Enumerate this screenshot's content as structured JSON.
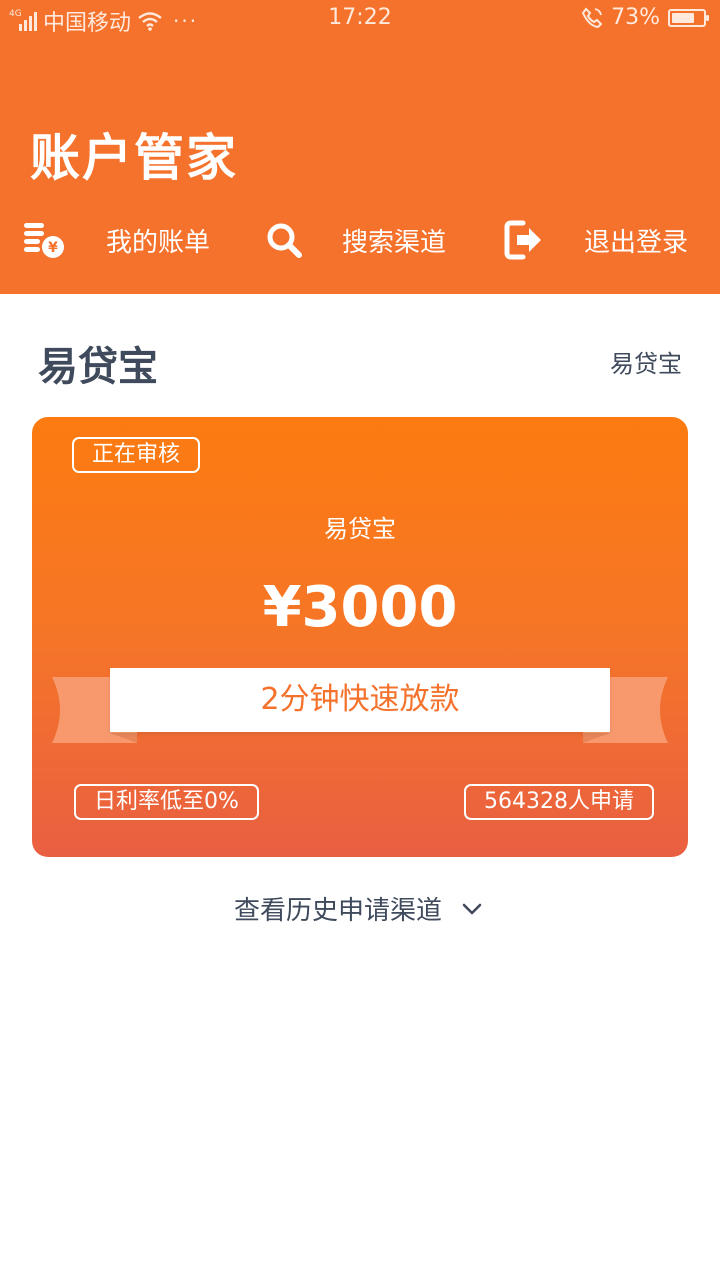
{
  "status_bar": {
    "network": "4G",
    "carrier": "中国移动",
    "time": "17:22",
    "battery": "73%",
    "battery_level": 0.73
  },
  "header": {
    "title": "账户管家",
    "bg_color": "#F5722D"
  },
  "nav": [
    {
      "label": "我的账单",
      "icon": "bill-coin-icon"
    },
    {
      "label": "搜索渠道",
      "icon": "search-icon"
    },
    {
      "label": "退出登录",
      "icon": "logout-icon"
    }
  ],
  "section": {
    "title": "易贷宝",
    "link": "易贷宝"
  },
  "card": {
    "status": "正在审核",
    "name": "易贷宝",
    "amount": "¥3000",
    "banner": "2分钟快速放款",
    "rate": "日利率低至0%",
    "applicants": "564328人申请"
  },
  "history": {
    "label": "查看历史申请渠道",
    "icon": "chevron-down-icon"
  }
}
